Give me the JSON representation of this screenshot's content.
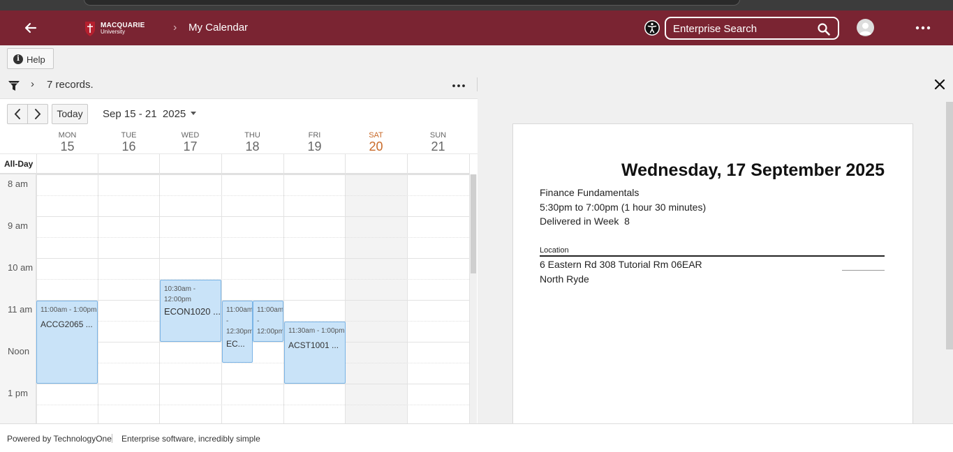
{
  "header": {
    "logo_line1": "MACQUARIE",
    "logo_line2": "University",
    "breadcrumb": "My Calendar",
    "search_placeholder": "Enterprise Search",
    "brand_color": "#7a2432"
  },
  "toolbar": {
    "help_label": "Help",
    "record_count": "7 records."
  },
  "calendar": {
    "today_label": "Today",
    "range_label": "Sep 15 - 21  2025",
    "all_day_label": "All-Day",
    "days": [
      {
        "name": "MON",
        "date": "15"
      },
      {
        "name": "TUE",
        "date": "16"
      },
      {
        "name": "WED",
        "date": "17"
      },
      {
        "name": "THU",
        "date": "18"
      },
      {
        "name": "FRI",
        "date": "19"
      },
      {
        "name": "SAT",
        "date": "20"
      },
      {
        "name": "SUN",
        "date": "21"
      }
    ],
    "hours": [
      "8 am",
      "9 am",
      "10 am",
      "11 am",
      "Noon",
      "1 pm"
    ],
    "events": [
      {
        "time": "11:00am - 1:00pm",
        "title": "ACCG2065 ..."
      },
      {
        "time": "10:30am - 12:00pm",
        "title": "ECON1020 ..."
      },
      {
        "time": "11:00am - 12:30pm",
        "title": "EC..."
      },
      {
        "time": "11:00am - 12:00pm",
        "title": ""
      },
      {
        "time": "11:30am - 1:00pm",
        "title": "ACST1001 ..."
      }
    ],
    "event_color": "#c9e3f8",
    "weekend_color": "#c96a29"
  },
  "detail": {
    "date": "Wednesday, 17 September 2025",
    "course": "Finance Fundamentals",
    "time": "5:30pm to 7:00pm (1 hour 30 minutes)",
    "week": "Delivered in Week  8",
    "location_label": "Location",
    "location_line1": "6 Eastern Rd 308 Tutorial Rm 06EAR",
    "location_line2": "North Ryde"
  },
  "footer": {
    "powered_by": "Powered by TechnologyOne",
    "tagline": "Enterprise software, incredibly simple"
  }
}
